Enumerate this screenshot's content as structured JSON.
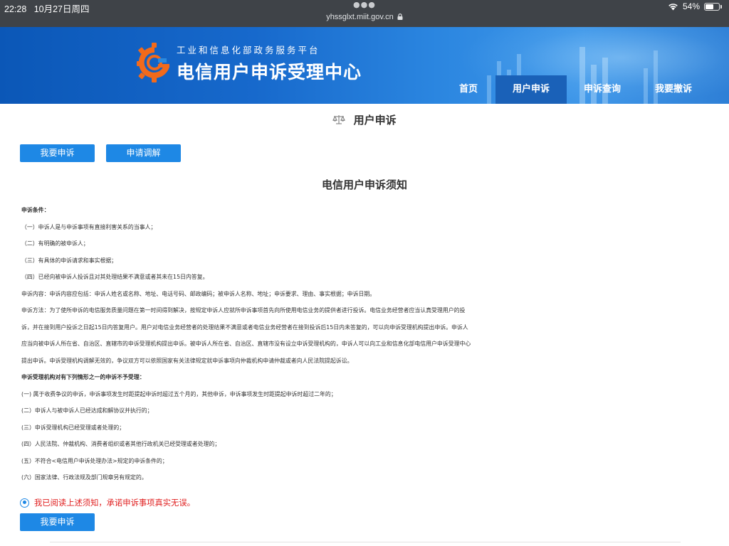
{
  "statusbar": {
    "time": "22:28",
    "date": "10月27日周四",
    "url": "yhssglxt.miit.gov.cn",
    "battery": "54%",
    "battery_level": 0.54,
    "icons": [
      "more-dots-icon",
      "lock-icon",
      "wifi-icon",
      "battery-icon"
    ]
  },
  "header": {
    "subtitle": "工业和信息化部政务服务平台",
    "title": "电信用户申诉受理中心",
    "nav": [
      {
        "label": "首页",
        "active": false
      },
      {
        "label": "用户申诉",
        "active": true
      },
      {
        "label": "申诉查询",
        "active": false
      },
      {
        "label": "我要撤诉",
        "active": false
      }
    ]
  },
  "page": {
    "title": "用户申诉",
    "title_icon": "scale-icon",
    "buttons": {
      "complain": "我要申诉",
      "mediation": "申请调解"
    }
  },
  "notice": {
    "title": "电信用户申诉须知",
    "conditions_heading": "申诉条件：",
    "conditions": [
      "（一）申诉人是与申诉事项有直接利害关系的当事人；",
      "（二）有明确的被申诉人；",
      "（三）有具体的申诉请求和事实根据；",
      "（四）已经向被申诉人投诉且对其处理结果不满意或者其未在15日内答复。"
    ],
    "content_text": "申诉内容：申诉内容应包括：申诉人姓名或名称、地址、电话号码、邮政编码；被申诉人名称、地址；申诉要求、理由、事实根据；申诉日期。",
    "method_lines": [
      "申诉方法：为了使所申诉的电信服务质量问题在第一时间得到解决，按规定申诉人应就所申诉事项首先向所使用电信业务的提供者进行投诉。电信业务经营者应当认真受理用户的投",
      "诉，并在接到用户投诉之日起15日内答复用户。用户对电信业务经营者的处理结果不满意或者电信业务经营者在接到投诉后15日内未答复的，可以向申诉受理机构提出申诉。申诉人",
      "应当向被申诉人所在省、自治区、直辖市的申诉受理机构提出申诉。被申诉人所在省、自治区、直辖市没有设立申诉受理机构的，申诉人可以向工业和信息化部电信用户申诉受理中心",
      "提出申诉。申诉受理机构调解无效的，争议双方可以依照国家有关法律规定就申诉事项向仲裁机构申请仲裁或者向人民法院提起诉讼。"
    ],
    "reject_heading": "申诉受理机构对有下列情形之一的申诉不予受理：",
    "reject_items": [
      "(一) 属于收费争议的申诉，申诉事项发生时距提起申诉时超过五个月的，其他申诉，申诉事项发生时距提起申诉时超过二年的；",
      "(二）申诉人与被申诉人已经达成和解协议并执行的；",
      "(三）申诉受理机构已经受理或者处理的；",
      "(四）人民法院、仲裁机构、消费者组织或者其他行政机关已经受理或者处理的；",
      "(五）不符合<电信用户申诉处理办法>规定的申诉条件的；",
      "(六）国家法律、行政法规及部门规章另有规定的。"
    ],
    "agree_text": "我已阅读上述须知，承诺申诉事项真实无误。",
    "agree_checked": true,
    "submit_button": "我要申诉"
  },
  "colors": {
    "header_blue": "#0b57b7",
    "nav_active": "#1a61b8",
    "button_blue": "#1e88e5",
    "agree_red": "#e02020",
    "logo_orange": "#f26a1b"
  }
}
